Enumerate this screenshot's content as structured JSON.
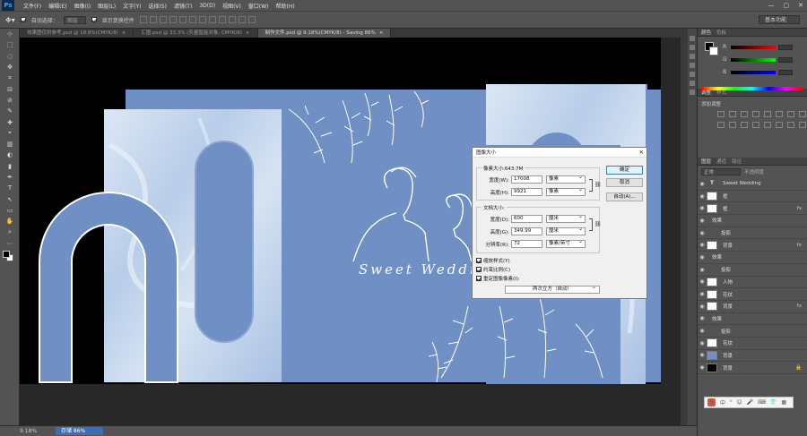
{
  "menubar": {
    "logo": "Ps",
    "items": [
      "文件(F)",
      "编辑(E)",
      "图像(I)",
      "图层(L)",
      "文字(Y)",
      "选择(S)",
      "滤镜(T)",
      "3D(D)",
      "视图(V)",
      "窗口(W)",
      "帮助(H)"
    ],
    "controls": [
      "—",
      "▢",
      "✕"
    ]
  },
  "options": {
    "auto_select_label": "自动选择：",
    "auto_select_value": "图层",
    "show_transform_label": "显示变换控件",
    "workspace": "基本功能"
  },
  "tabs": [
    {
      "label": "效果图仅供参考.psd @ 18.8%(CMYK/8)",
      "close": "×"
    },
    {
      "label": "汇图.psd @ 33.3% (矢量智能对象, CMYK/8)",
      "close": "×"
    },
    {
      "label": "制作文件.psd @ 9.18%(CMYK/8) - Saving 86%",
      "close": "×"
    }
  ],
  "tools": [
    "⊹",
    "⬚",
    "◌",
    "✥",
    "⌗",
    "⊟",
    "⊘",
    "✎",
    "✚",
    "⌖",
    "▥",
    "◐",
    "▮",
    "✒",
    "T",
    "↖",
    "▭",
    "✋",
    "⌕",
    "⋯"
  ],
  "canvas": {
    "text": "Sweet Wedding",
    "colors": {
      "blue": "#6f8fc5",
      "marble": "#c4d6ee",
      "black": "#000000"
    }
  },
  "dialog": {
    "title": "图像大小",
    "close": "✕",
    "pixel_dims": "像素大小:643.7M",
    "width_label": "宽度(W):",
    "width_value": "17008",
    "width_unit": "像素",
    "height_label": "高度(H):",
    "height_value": "9921",
    "height_unit": "像素",
    "doc_size": "文档大小:",
    "doc_width_label": "宽度(D):",
    "doc_width_value": "600",
    "doc_width_unit": "厘米",
    "doc_height_label": "高度(G):",
    "doc_height_value": "349.99",
    "doc_height_unit": "厘米",
    "resolution_label": "分辨率(R):",
    "resolution_value": "72",
    "resolution_unit": "像素/英寸",
    "ok": "确定",
    "cancel": "取消",
    "auto": "自动(A)...",
    "scale_styles": "缩放样式(Y)",
    "constrain": "约束比例(C)",
    "resample": "重定图像像素(I):",
    "resample_method": "两次立方（自动）"
  },
  "panels": {
    "color_tabs": [
      "颜色",
      "色板"
    ],
    "rgb": [
      "R",
      "G",
      "B"
    ],
    "adjust_tabs": [
      "调整",
      "样式"
    ],
    "adjust_title": "添加调整",
    "layer_tabs": [
      "图层",
      "通道",
      "路径"
    ],
    "kind": "正常",
    "opacity": "不透明度",
    "fill": "填充",
    "layers": [
      {
        "name": "Sweet Wedding",
        "thumb": "T",
        "fx": ""
      },
      {
        "name": "框",
        "thumb": "white",
        "fx": ""
      },
      {
        "name": "框",
        "thumb": "white",
        "fx": "fx"
      },
      {
        "name": "效果",
        "thumb": "sub",
        "fx": ""
      },
      {
        "name": "投影",
        "thumb": "sub2",
        "fx": ""
      },
      {
        "name": "背景",
        "thumb": "white",
        "fx": "fx"
      },
      {
        "name": "效果",
        "thumb": "sub",
        "fx": ""
      },
      {
        "name": "投影",
        "thumb": "sub2",
        "fx": ""
      },
      {
        "name": "人物",
        "thumb": "white",
        "fx": ""
      },
      {
        "name": "花纹",
        "thumb": "white",
        "fx": ""
      },
      {
        "name": "背景",
        "thumb": "white",
        "fx": "fx"
      },
      {
        "name": "效果",
        "thumb": "sub",
        "fx": ""
      },
      {
        "name": "投影",
        "thumb": "sub2",
        "fx": ""
      },
      {
        "name": "花纹",
        "thumb": "white",
        "fx": ""
      },
      {
        "name": "背景",
        "thumb": "blue",
        "fx": ""
      },
      {
        "name": "背景",
        "thumb": "black",
        "fx": "🔒"
      }
    ]
  },
  "status": {
    "zoom": "9.18%",
    "progress_label": "存储 86%",
    "progress": 0.86
  },
  "ime": {
    "logo": "S",
    "items": [
      "中",
      "⁰",
      "☺",
      "🎤",
      "⌨",
      "👕",
      "▦"
    ]
  }
}
